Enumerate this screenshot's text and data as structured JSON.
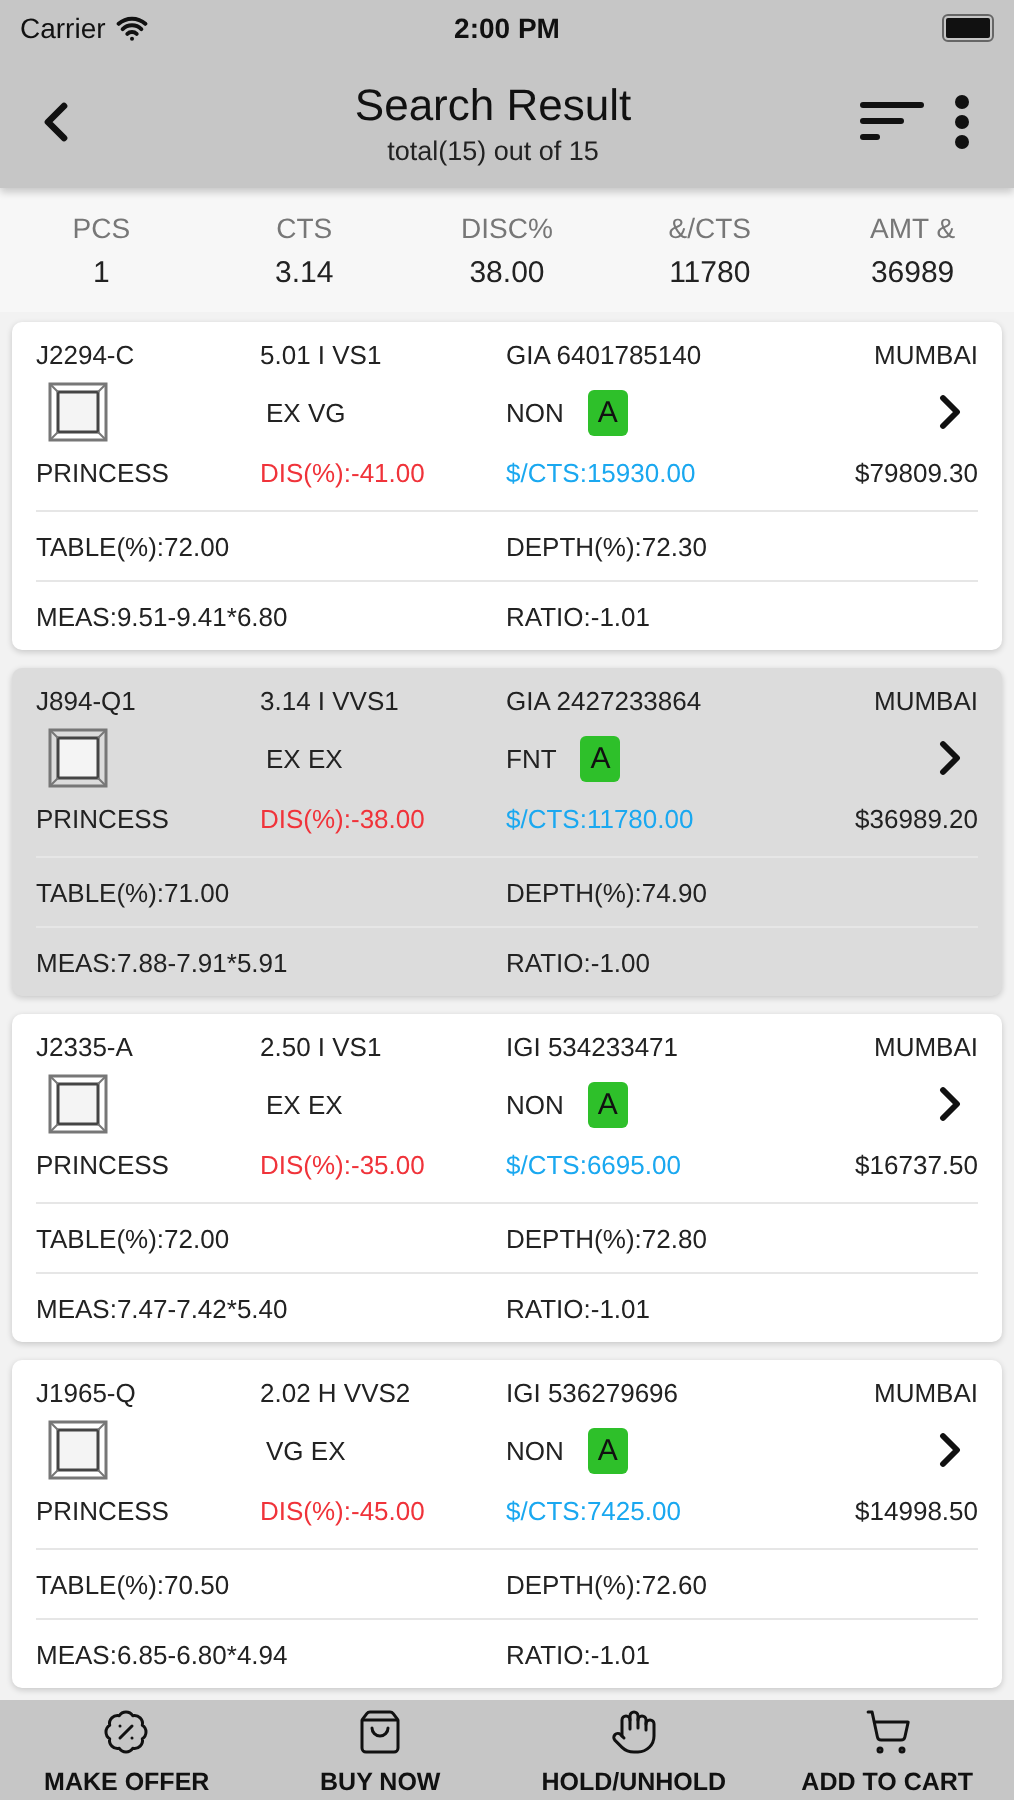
{
  "status_bar": {
    "carrier": "Carrier",
    "time": "2:00 PM"
  },
  "header": {
    "title": "Search Result",
    "subtitle": "total(15) out of 15"
  },
  "summary": [
    {
      "label": "PCS",
      "value": "1"
    },
    {
      "label": "CTS",
      "value": "3.14"
    },
    {
      "label": "DISC%",
      "value": "38.00"
    },
    {
      "label": "&/CTS",
      "value": "11780"
    },
    {
      "label": "AMT &",
      "value": "36989"
    }
  ],
  "cards": [
    {
      "stock_id": "J2294-C",
      "size_clarity": "5.01 I VS1",
      "lab_cert": "GIA 6401785140",
      "location": "MUMBAI",
      "cut_polish": "EX VG",
      "fluorescence": "NON",
      "grade": "A",
      "shape": "PRINCESS",
      "discount": "DIS(%):-41.00",
      "price_per_carat": "$/CTS:15930.00",
      "amount": "$79809.30",
      "table": "TABLE(%):72.00",
      "depth": "DEPTH(%):72.30",
      "meas": "MEAS:9.51-9.41*6.80",
      "ratio": "RATIO:-1.01",
      "selected": false
    },
    {
      "stock_id": "J894-Q1",
      "size_clarity": "3.14 I VVS1",
      "lab_cert": "GIA 2427233864",
      "location": "MUMBAI",
      "cut_polish": "EX EX",
      "fluorescence": "FNT",
      "grade": "A",
      "shape": "PRINCESS",
      "discount": "DIS(%):-38.00",
      "price_per_carat": "$/CTS:11780.00",
      "amount": "$36989.20",
      "table": "TABLE(%):71.00",
      "depth": "DEPTH(%):74.90",
      "meas": "MEAS:7.88-7.91*5.91",
      "ratio": "RATIO:-1.00",
      "selected": true
    },
    {
      "stock_id": "J2335-A",
      "size_clarity": "2.50 I VS1",
      "lab_cert": "IGI 534233471",
      "location": "MUMBAI",
      "cut_polish": "EX EX",
      "fluorescence": "NON",
      "grade": "A",
      "shape": "PRINCESS",
      "discount": "DIS(%):-35.00",
      "price_per_carat": "$/CTS:6695.00",
      "amount": "$16737.50",
      "table": "TABLE(%):72.00",
      "depth": "DEPTH(%):72.80",
      "meas": "MEAS:7.47-7.42*5.40",
      "ratio": "RATIO:-1.01",
      "selected": false
    },
    {
      "stock_id": "J1965-Q",
      "size_clarity": "2.02 H VVS2",
      "lab_cert": "IGI 536279696",
      "location": "MUMBAI",
      "cut_polish": "VG EX",
      "fluorescence": "NON",
      "grade": "A",
      "shape": "PRINCESS",
      "discount": "DIS(%):-45.00",
      "price_per_carat": "$/CTS:7425.00",
      "amount": "$14998.50",
      "table": "TABLE(%):70.50",
      "depth": "DEPTH(%):72.60",
      "meas": "MEAS:6.85-6.80*4.94",
      "ratio": "RATIO:-1.01",
      "selected": false
    }
  ],
  "actions": [
    {
      "label": "MAKE OFFER"
    },
    {
      "label": "BUY NOW"
    },
    {
      "label": "HOLD/UNHOLD"
    },
    {
      "label": "ADD TO CART"
    }
  ]
}
